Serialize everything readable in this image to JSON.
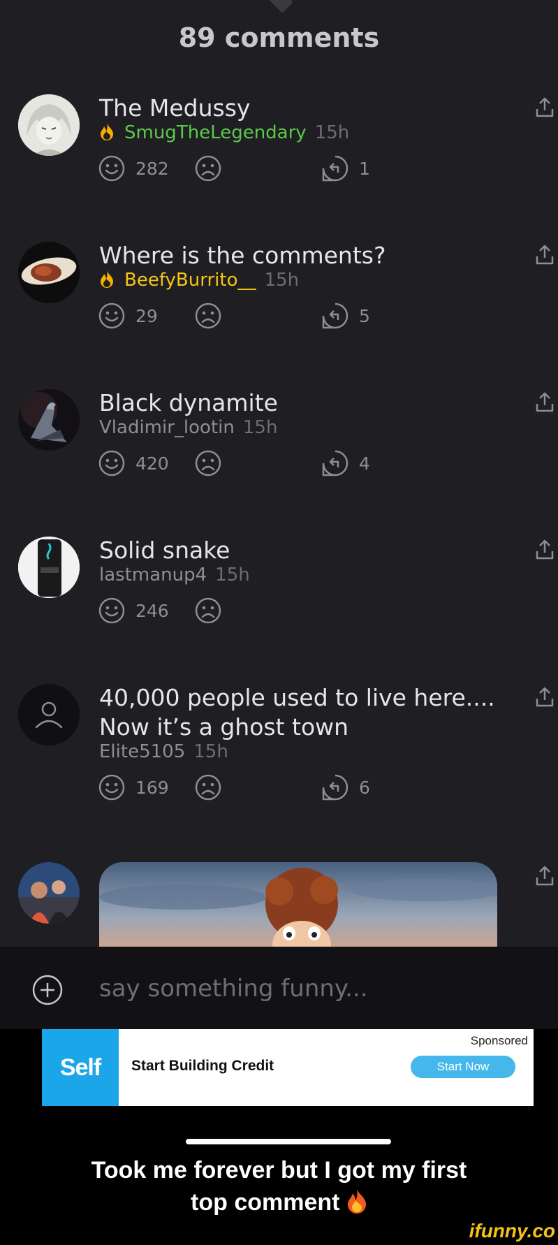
{
  "header": {
    "comment_count": "89 comments"
  },
  "comments": [
    {
      "text": "The Medussy",
      "user": "SmugTheLegendary",
      "time": "15h",
      "badge": "fire-badge",
      "user_color": "#5cc94a",
      "smiles": "282",
      "replies": "1"
    },
    {
      "text": "Where is the comments?",
      "user": "BeefyBurrito__",
      "time": "15h",
      "badge": "fire-badge",
      "user_color": "#f5c515",
      "smiles": "29",
      "replies": "5"
    },
    {
      "text": "Black dynamite",
      "user": "Vladimir_lootin",
      "time": "15h",
      "smiles": "420",
      "replies": "4"
    },
    {
      "text": "Solid snake",
      "user": "lastmanup4",
      "time": "15h",
      "smiles": "246"
    },
    {
      "text": "40,000 people used to live here.... Now it’s a ghost town",
      "user": "Elite5105",
      "time": "15h",
      "smiles": "169",
      "replies": "6"
    }
  ],
  "composer": {
    "placeholder": "say something funny..."
  },
  "ad": {
    "brand": "Self",
    "headline": "Start Building Credit",
    "sponsored": "Sponsored",
    "cta": "Start Now"
  },
  "caption": {
    "line1": "Took me forever but I got my first",
    "line2": "top comment"
  },
  "watermark": "ifunny.co",
  "colors": {
    "background": "#1e1e23",
    "accent_green": "#5cc94a",
    "accent_yellow": "#f5c515",
    "ad_blue": "#1aa6e8"
  }
}
